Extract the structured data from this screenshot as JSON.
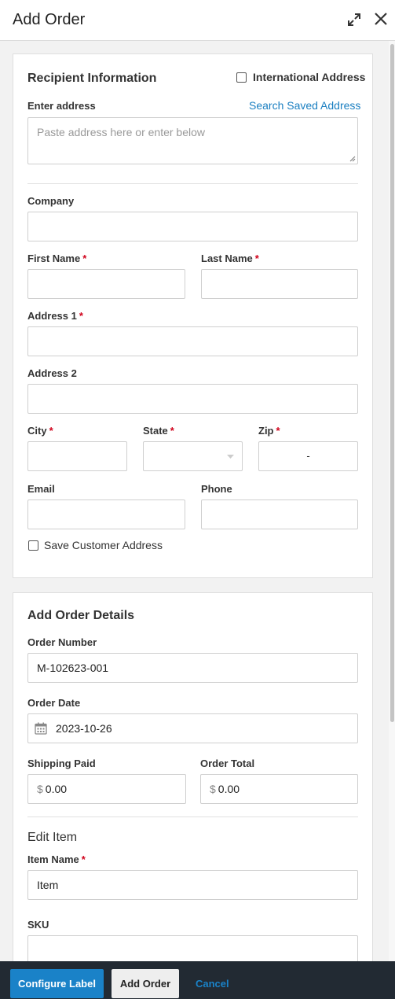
{
  "header": {
    "title": "Add Order",
    "expand_icon": "expand-icon",
    "close_icon": "close-icon"
  },
  "recipient": {
    "heading": "Recipient Information",
    "international_label": "International Address",
    "international_checked": false,
    "enter_address_label": "Enter address",
    "search_saved_link": "Search Saved Address",
    "address_placeholder": "Paste address here or enter below",
    "company_label": "Company",
    "first_name_label": "First Name",
    "last_name_label": "Last Name",
    "address1_label": "Address 1",
    "address2_label": "Address 2",
    "city_label": "City",
    "state_label": "State",
    "zip_label": "Zip",
    "zip_separator": "-",
    "email_label": "Email",
    "phone_label": "Phone",
    "required_mark": "*",
    "save_customer_label": "Save Customer Address",
    "save_customer_checked": false
  },
  "order_details": {
    "heading": "Add Order Details",
    "order_number_label": "Order Number",
    "order_number_value": "M-102623-001",
    "order_date_label": "Order Date",
    "order_date_value": "2023-10-26",
    "shipping_paid_label": "Shipping Paid",
    "shipping_paid_value": "0.00",
    "order_total_label": "Order Total",
    "order_total_value": "0.00",
    "currency_symbol": "$"
  },
  "edit_item": {
    "heading": "Edit Item",
    "item_name_label": "Item Name",
    "item_name_value": "Item",
    "sku_label": "SKU"
  },
  "footer": {
    "configure_label_button": "Configure Label",
    "add_order_button": "Add Order",
    "cancel_link": "Cancel"
  },
  "colors": {
    "accent": "#1a82c8",
    "link": "#1a7fc1",
    "required": "#d0021b",
    "footer_bg": "#222a33"
  }
}
